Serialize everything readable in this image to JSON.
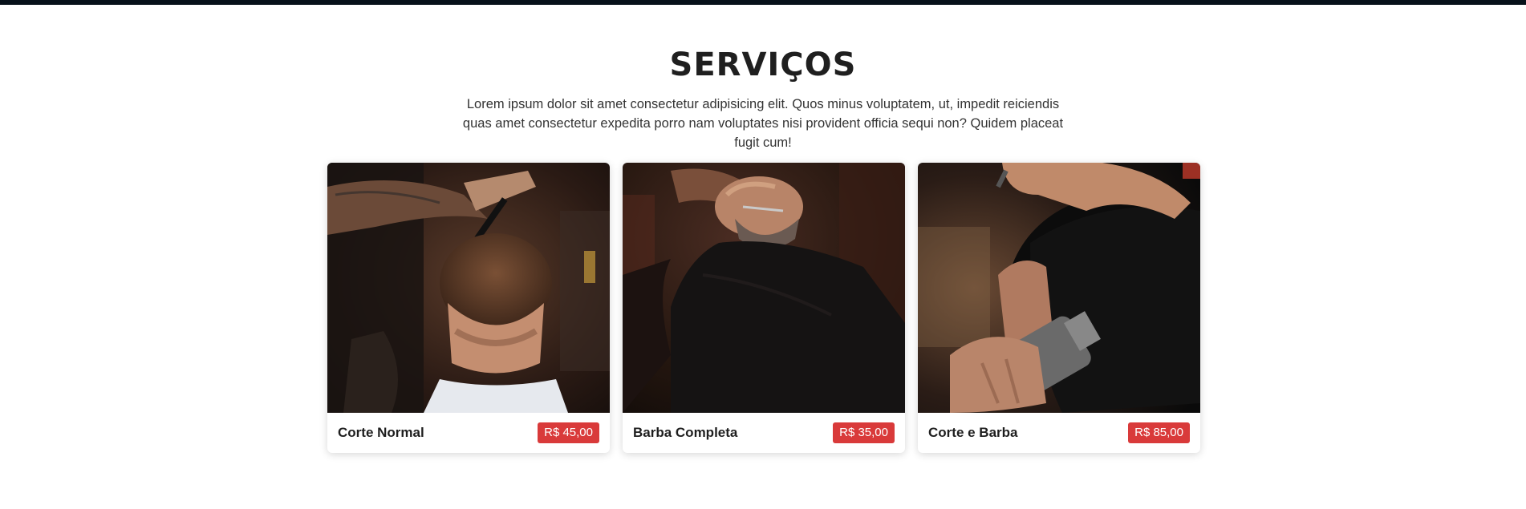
{
  "section": {
    "title": "SERVIÇOS",
    "intro": "Lorem ipsum dolor sit amet consectetur adipisicing elit. Quos minus voluptatem, ut, impedit reiciendis quas amet consectetur expedita porro nam voluptates nisi provident officia sequi non? Quidem placeat fugit cum!"
  },
  "services": [
    {
      "name": "Corte Normal",
      "price": "R$ 45,00",
      "image": "haircut-photo"
    },
    {
      "name": "Barba Completa",
      "price": "R$ 35,00",
      "image": "beard-trim-photo"
    },
    {
      "name": "Corte e Barba",
      "price": "R$ 85,00",
      "image": "clipper-cut-photo"
    }
  ],
  "colors": {
    "top_bar": "#07111a",
    "price_badge": "#d93a3a",
    "title": "#1f1f1f"
  }
}
